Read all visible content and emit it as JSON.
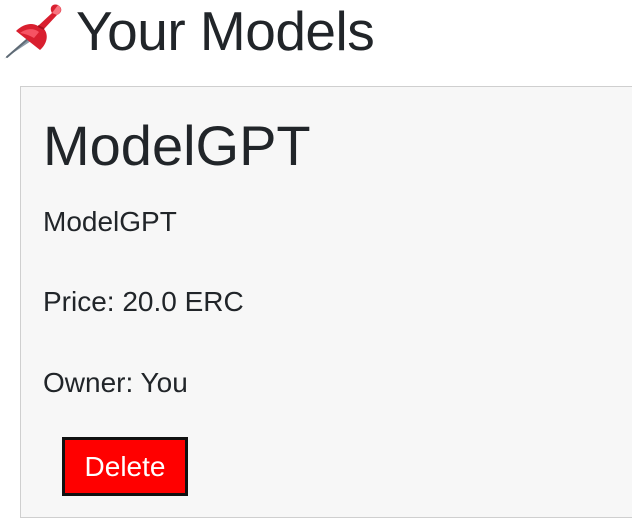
{
  "header": {
    "icon": "pushpin-icon",
    "title": "Your Models"
  },
  "card": {
    "title": "ModelGPT",
    "name": "ModelGPT",
    "price_label": "Price:",
    "price_value": "20.0 ERC",
    "owner_label": "Owner:",
    "owner_value": "You",
    "delete_label": "Delete"
  },
  "colors": {
    "delete_background": "#ff0000",
    "card_background": "#f7f7f7"
  }
}
